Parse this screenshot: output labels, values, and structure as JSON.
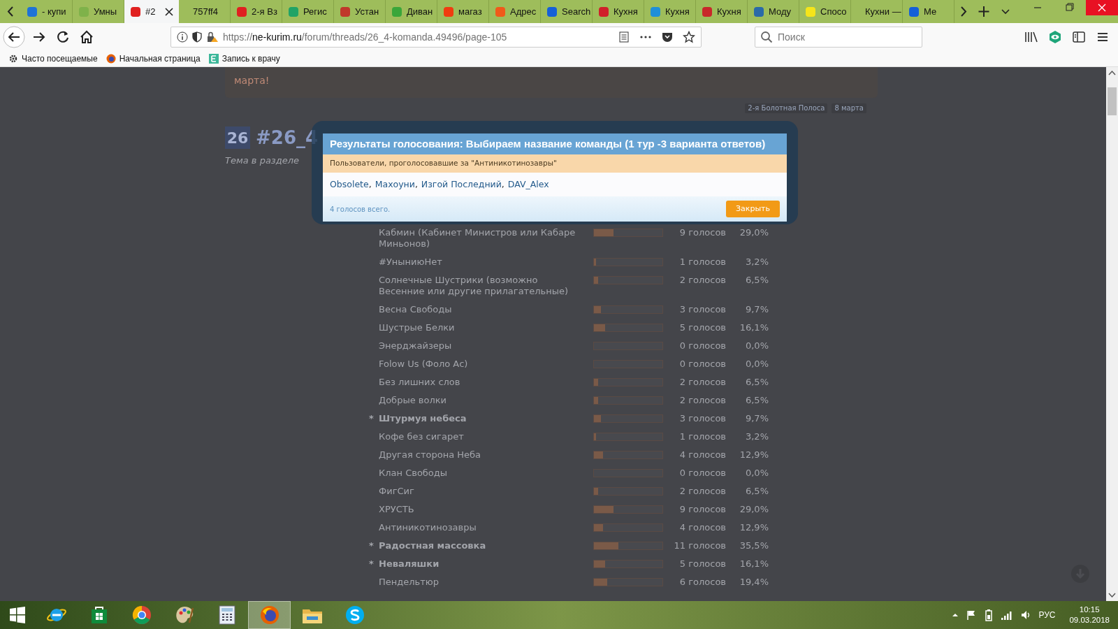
{
  "browser": {
    "tabs": [
      {
        "label": "- купи",
        "color": "#1e73d6",
        "selected": false
      },
      {
        "label": "Умны",
        "color": "#7fb24a",
        "selected": false
      },
      {
        "label": "#2",
        "color": "#e02020",
        "selected": true
      },
      {
        "label": "757ff4",
        "selected": false
      },
      {
        "label": "2-я Вз",
        "color": "#e02020",
        "selected": false
      },
      {
        "label": "Регис",
        "color": "#21a366",
        "selected": false
      },
      {
        "label": "Устан",
        "color": "#c0392b",
        "selected": false
      },
      {
        "label": "Диван",
        "color": "#3aa63a",
        "selected": false
      },
      {
        "label": "магаз",
        "color": "#f03c10",
        "selected": false
      },
      {
        "label": "Адрес",
        "color": "#f05a1a",
        "selected": false
      },
      {
        "label": "Search",
        "color": "#1560d8",
        "selected": false
      },
      {
        "label": "Кухня",
        "color": "#d0202a",
        "selected": false
      },
      {
        "label": "Кухня",
        "color": "#1f8fd8",
        "selected": false
      },
      {
        "label": "Кухня",
        "color": "#c8282a",
        "selected": false
      },
      {
        "label": "Моду",
        "color": "#2a6aa8",
        "selected": false
      },
      {
        "label": "Спосо",
        "color": "#f5e51a",
        "selected": false
      },
      {
        "label": "Кухни —",
        "selected": false
      },
      {
        "label": "Ме",
        "color": "#1560d8",
        "selected": false
      }
    ],
    "url": {
      "scheme": "https://",
      "domain": "ne-kurim.ru",
      "path": "/forum/threads/26_4-komanda.49496/page-105"
    },
    "search": {
      "placeholder": "Поиск"
    },
    "bookmarks": [
      {
        "label": "Часто посещаемые",
        "kind": "gear"
      },
      {
        "label": "Начальная страница",
        "kind": "firefox"
      },
      {
        "label": "Запись к врачу",
        "kind": "letter"
      }
    ]
  },
  "page": {
    "greeting_tail": "марта!",
    "breadcrumbs": [
      "2-я Болотная Полоса",
      "8 марта"
    ],
    "thread_badge": "26",
    "thread_title": "#26_4",
    "thread_subtitle": "Тема в разделе",
    "poll_rows": [
      {
        "label": "Кабмин (Кабинет Министров или Кабаре Миньонов)",
        "voted": false,
        "level": 0.29,
        "votes": "9 голосов",
        "percent": "29,0%"
      },
      {
        "label": "#УныниюНет",
        "voted": false,
        "level": 0.032,
        "votes": "1 голосов",
        "percent": "3,2%"
      },
      {
        "label": "Солнечные Шустрики (возможно Весенние или другие прилагательные)",
        "voted": false,
        "level": 0.065,
        "votes": "2 голосов",
        "percent": "6,5%"
      },
      {
        "label": "Весна Свободы",
        "voted": false,
        "level": 0.097,
        "votes": "3 голосов",
        "percent": "9,7%"
      },
      {
        "label": "Шустрые Белки",
        "voted": false,
        "level": 0.161,
        "votes": "5 голосов",
        "percent": "16,1%"
      },
      {
        "label": "Энерджайзеры",
        "voted": false,
        "level": 0,
        "votes": "0 голосов",
        "percent": "0,0%"
      },
      {
        "label": "Folow Us (Фоло Ас)",
        "voted": false,
        "level": 0,
        "votes": "0 голосов",
        "percent": "0,0%"
      },
      {
        "label": "Без лишних слов",
        "voted": false,
        "level": 0.065,
        "votes": "2 голосов",
        "percent": "6,5%"
      },
      {
        "label": "Добрые волки",
        "voted": false,
        "level": 0.065,
        "votes": "2 голосов",
        "percent": "6,5%"
      },
      {
        "label": "Штурмуя небеса",
        "voted": true,
        "level": 0.097,
        "votes": "3 голосов",
        "percent": "9,7%"
      },
      {
        "label": "Кофе без сигарет",
        "voted": false,
        "level": 0.032,
        "votes": "1 голосов",
        "percent": "3,2%"
      },
      {
        "label": "Другая сторона Неба",
        "voted": false,
        "level": 0.129,
        "votes": "4 голосов",
        "percent": "12,9%"
      },
      {
        "label": "Клан Свободы",
        "voted": false,
        "level": 0,
        "votes": "0 голосов",
        "percent": "0,0%"
      },
      {
        "label": "ФигСиг",
        "voted": false,
        "level": 0.065,
        "votes": "2 голосов",
        "percent": "6,5%"
      },
      {
        "label": "ХРУСТЬ",
        "voted": false,
        "level": 0.29,
        "votes": "9 голосов",
        "percent": "29,0%"
      },
      {
        "label": "Антиникотинозавры",
        "voted": false,
        "level": 0.129,
        "votes": "4 голосов",
        "percent": "12,9%"
      },
      {
        "label": "Радостная массовка",
        "voted": true,
        "level": 0.355,
        "votes": "11 голосов",
        "percent": "35,5%"
      },
      {
        "label": "Неваляшки",
        "voted": true,
        "level": 0.161,
        "votes": "5 голосов",
        "percent": "16,1%"
      },
      {
        "label": "Пендельтюр",
        "voted": false,
        "level": 0.194,
        "votes": "6 голосов",
        "percent": "19,4%"
      }
    ],
    "voted_mark": "*"
  },
  "dialog": {
    "title": "Результаты голосования: Выбираем название команды (1 тур -3 варианта ответов)",
    "voters_heading": "Пользователи, проголосовавшие за \"Антиникотинозавры\"",
    "voters": [
      "Obsolete",
      "Махоуни",
      "Изгой Последний",
      "DAV_Alex"
    ],
    "separator": ",",
    "total": "4 голосов всего.",
    "close_button": "Закрыть"
  },
  "taskbar": {
    "apps": [
      {
        "kind": "ie",
        "active": false
      },
      {
        "kind": "store",
        "active": false
      },
      {
        "kind": "chrome",
        "active": false
      },
      {
        "kind": "paint",
        "active": false
      },
      {
        "kind": "calculator",
        "active": false
      },
      {
        "kind": "firefox",
        "active": true
      },
      {
        "kind": "explorer",
        "active": false
      },
      {
        "kind": "skype",
        "active": false
      }
    ],
    "language": "РУС",
    "time": "10:15",
    "date": "09.03.2018"
  }
}
